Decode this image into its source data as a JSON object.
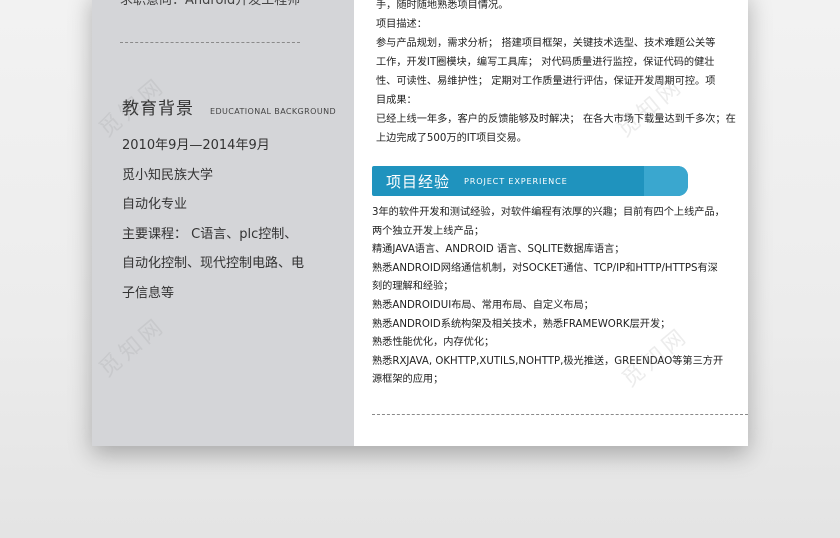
{
  "left": {
    "cut_text": "求职意向：Android开发工程师",
    "edu_title": "教育背景",
    "edu_title_en": "EDUCATIONAL BACKGROUND",
    "edu_items": [
      "2010年9月—2014年9月",
      "觅小知民族大学",
      "自动化专业",
      "主要课程：  C语言、plc控制、",
      "自动化控制、现代控制电路、电",
      "子信息等"
    ]
  },
  "right": {
    "top_lines": [
      "手，随时随地熟悉项目情况。",
      "项目描述：",
      "参与产品规划，需求分析；  搭建项目框架，关键技术选型、技术难题公关等",
      "工作，开发IT圈模块，编写工具库；  对代码质量进行监控，保证代码的健壮",
      "性、可读性、易维护性；  定期对工作质量进行评估，保证开发周期可控。项",
      "目成果：",
      "已经上线一年多，客户的反馈能够及时解决；  在各大市场下载量达到千多次；在",
      "上边完成了500万的IT项目交易。"
    ],
    "section_title": "项目经验",
    "section_title_en": "PROJECT  EXPERIENCE",
    "project_lines": [
      "3年的软件开发和测试经验，对软件编程有浓厚的兴趣；目前有四个上线产品，",
      "两个独立开发上线产品；",
      "精通JAVA语言、ANDROID 语言、SQLITE数据库语言；",
      "熟悉ANDROID网络通信机制，对SOCKET通信、TCP/IP和HTTP/HTTPS有深",
      "刻的理解和经验；",
      "熟悉ANDROIDUI布局、常用布局、自定义布局；",
      "熟悉ANDROID系统构架及相关技术，熟悉FRAMEWORK层开发；",
      "熟悉性能优化，内存优化；",
      "熟悉RXJAVA, OKHTTP,XUTILS,NOHTTP,极光推送，GREENDAO等第三方开",
      "源框架的应用；"
    ]
  },
  "watermark": "觅知网",
  "colors": {
    "page_bg": "#ececec",
    "left_panel": "#d4d5d8",
    "section_bar": "#1f93be"
  }
}
